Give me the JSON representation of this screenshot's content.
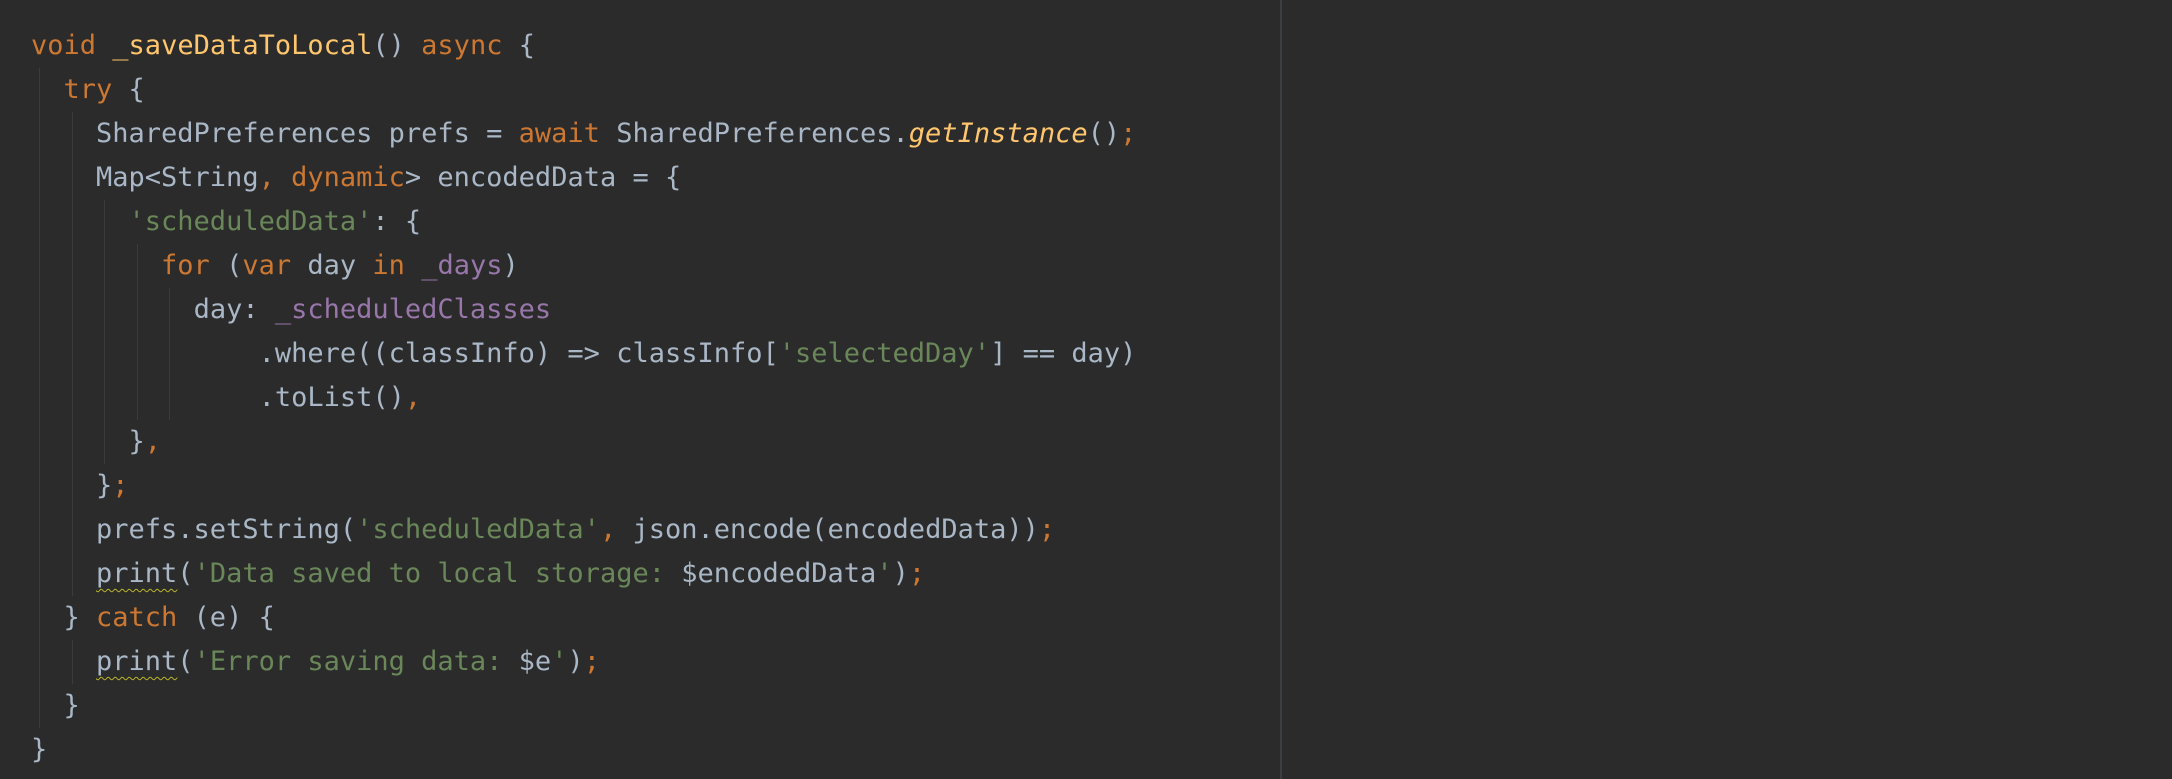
{
  "editor": {
    "language": "dart",
    "colors": {
      "background": "#2b2b2b",
      "keyword": "#cc7832",
      "string": "#6a8759",
      "method": "#ffc66d",
      "field": "#9876aa",
      "plain": "#a9b7c6",
      "warning_underline": "#bbb529"
    },
    "lines": [
      {
        "indent": 0,
        "tokens": [
          {
            "t": "kw",
            "text": "void"
          },
          {
            "t": "pl",
            "text": " "
          },
          {
            "t": "fn-plain",
            "text": "_saveDataToLocal"
          },
          {
            "t": "pl",
            "text": "() "
          },
          {
            "t": "kw",
            "text": "async"
          },
          {
            "t": "pl",
            "text": " {"
          }
        ]
      },
      {
        "indent": 1,
        "tokens": [
          {
            "t": "kw",
            "text": "try"
          },
          {
            "t": "pl",
            "text": " {"
          }
        ]
      },
      {
        "indent": 2,
        "tokens": [
          {
            "t": "pl",
            "text": "SharedPreferences prefs = "
          },
          {
            "t": "kw",
            "text": "await"
          },
          {
            "t": "pl",
            "text": " SharedPreferences."
          },
          {
            "t": "fn",
            "text": "getInstance"
          },
          {
            "t": "pl",
            "text": "()"
          },
          {
            "t": "kw",
            "text": ";"
          }
        ]
      },
      {
        "indent": 2,
        "tokens": [
          {
            "t": "pl",
            "text": "Map<String"
          },
          {
            "t": "kw",
            "text": ", "
          },
          {
            "t": "kw",
            "text": "dynamic"
          },
          {
            "t": "pl",
            "text": "> encodedData = {"
          }
        ]
      },
      {
        "indent": 3,
        "tokens": [
          {
            "t": "str",
            "text": "'scheduledData'"
          },
          {
            "t": "pl",
            "text": ": {"
          }
        ]
      },
      {
        "indent": 4,
        "tokens": [
          {
            "t": "kw",
            "text": "for"
          },
          {
            "t": "pl",
            "text": " ("
          },
          {
            "t": "kw",
            "text": "var"
          },
          {
            "t": "pl",
            "text": " day "
          },
          {
            "t": "kw",
            "text": "in"
          },
          {
            "t": "pl",
            "text": " "
          },
          {
            "t": "field",
            "text": "_days"
          },
          {
            "t": "pl",
            "text": ")"
          }
        ]
      },
      {
        "indent": 5,
        "tokens": [
          {
            "t": "pl",
            "text": "day: "
          },
          {
            "t": "field",
            "text": "_scheduledClasses"
          }
        ]
      },
      {
        "indent": 7,
        "tokens": [
          {
            "t": "pl",
            "text": ".where((classInfo) => classInfo["
          },
          {
            "t": "str",
            "text": "'selectedDay'"
          },
          {
            "t": "pl",
            "text": "] == day)"
          }
        ]
      },
      {
        "indent": 7,
        "tokens": [
          {
            "t": "pl",
            "text": ".toList()"
          },
          {
            "t": "kw",
            "text": ","
          }
        ]
      },
      {
        "indent": 3,
        "tokens": [
          {
            "t": "pl",
            "text": "}"
          },
          {
            "t": "kw",
            "text": ","
          }
        ]
      },
      {
        "indent": 2,
        "tokens": [
          {
            "t": "pl",
            "text": "}"
          },
          {
            "t": "kw",
            "text": ";"
          }
        ]
      },
      {
        "indent": 2,
        "tokens": [
          {
            "t": "pl",
            "text": "prefs.setString("
          },
          {
            "t": "str",
            "text": "'scheduledData'"
          },
          {
            "t": "kw",
            "text": ", "
          },
          {
            "t": "pl",
            "text": "json.encode(encodedData))"
          },
          {
            "t": "kw",
            "text": ";"
          }
        ]
      },
      {
        "indent": 2,
        "tokens": [
          {
            "t": "warn",
            "text": "print"
          },
          {
            "t": "pl",
            "text": "("
          },
          {
            "t": "str",
            "text": "'Data saved to local storage: "
          },
          {
            "t": "pl",
            "text": "$encodedData"
          },
          {
            "t": "str",
            "text": "'"
          },
          {
            "t": "pl",
            "text": ")"
          },
          {
            "t": "kw",
            "text": ";"
          }
        ]
      },
      {
        "indent": 1,
        "tokens": [
          {
            "t": "pl",
            "text": "} "
          },
          {
            "t": "kw",
            "text": "catch"
          },
          {
            "t": "pl",
            "text": " (e) {"
          }
        ]
      },
      {
        "indent": 2,
        "tokens": [
          {
            "t": "warn",
            "text": "print"
          },
          {
            "t": "pl",
            "text": "("
          },
          {
            "t": "str",
            "text": "'Error saving data: "
          },
          {
            "t": "pl",
            "text": "$e"
          },
          {
            "t": "str",
            "text": "'"
          },
          {
            "t": "pl",
            "text": ")"
          },
          {
            "t": "kw",
            "text": ";"
          }
        ]
      },
      {
        "indent": 1,
        "tokens": [
          {
            "t": "pl",
            "text": "}"
          }
        ]
      },
      {
        "indent": 0,
        "tokens": [
          {
            "t": "pl",
            "text": "}"
          }
        ]
      }
    ]
  }
}
